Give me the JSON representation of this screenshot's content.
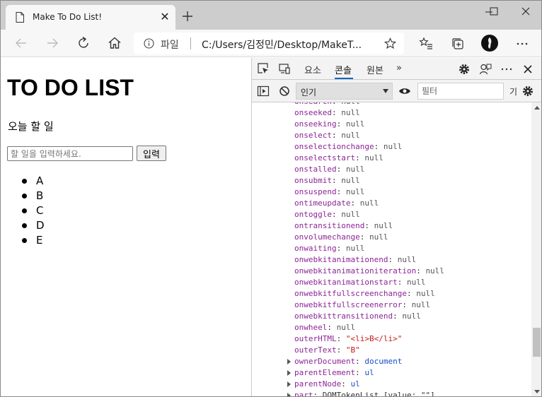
{
  "browser": {
    "tab_title": "Make To Do List!",
    "tab_close": "✕",
    "address": {
      "scheme_label": "파일",
      "url": "C:/Users/김정민/Desktop/MakeT..."
    }
  },
  "page": {
    "heading": "TO DO LIST",
    "subtitle": "오늘 할 일",
    "input_placeholder": "할 일을 입력하세요.",
    "add_button": "입력",
    "items": [
      "A",
      "B",
      "C",
      "D",
      "E"
    ]
  },
  "devtools": {
    "tabs": [
      "요소",
      "콘솔",
      "원본"
    ],
    "active_tab": "콘솔",
    "more_tabs": "»",
    "context": "인기",
    "filter_placeholder": "필터",
    "levels_label": "기",
    "lines": [
      {
        "key": "onsearch",
        "val": "null",
        "type": "null"
      },
      {
        "key": "onseeked",
        "val": "null",
        "type": "null"
      },
      {
        "key": "onseeking",
        "val": "null",
        "type": "null"
      },
      {
        "key": "onselect",
        "val": "null",
        "type": "null"
      },
      {
        "key": "onselectionchange",
        "val": "null",
        "type": "null"
      },
      {
        "key": "onselectstart",
        "val": "null",
        "type": "null"
      },
      {
        "key": "onstalled",
        "val": "null",
        "type": "null"
      },
      {
        "key": "onsubmit",
        "val": "null",
        "type": "null"
      },
      {
        "key": "onsuspend",
        "val": "null",
        "type": "null"
      },
      {
        "key": "ontimeupdate",
        "val": "null",
        "type": "null"
      },
      {
        "key": "ontoggle",
        "val": "null",
        "type": "null"
      },
      {
        "key": "ontransitionend",
        "val": "null",
        "type": "null"
      },
      {
        "key": "onvolumechange",
        "val": "null",
        "type": "null"
      },
      {
        "key": "onwaiting",
        "val": "null",
        "type": "null"
      },
      {
        "key": "onwebkitanimationend",
        "val": "null",
        "type": "null"
      },
      {
        "key": "onwebkitanimationiteration",
        "val": "null",
        "type": "null"
      },
      {
        "key": "onwebkitanimationstart",
        "val": "null",
        "type": "null"
      },
      {
        "key": "onwebkitfullscreenchange",
        "val": "null",
        "type": "null"
      },
      {
        "key": "onwebkitfullscreenerror",
        "val": "null",
        "type": "null"
      },
      {
        "key": "onwebkittransitionend",
        "val": "null",
        "type": "null"
      },
      {
        "key": "onwheel",
        "val": "null",
        "type": "null"
      },
      {
        "key": "outerHTML",
        "val": "\"<li>B</li>\"",
        "type": "string"
      },
      {
        "key": "outerText",
        "val": "\"B\"",
        "type": "string"
      },
      {
        "key": "ownerDocument",
        "val": "document",
        "type": "object",
        "expandable": true
      },
      {
        "key": "parentElement",
        "val": "ul",
        "type": "object",
        "expandable": true
      },
      {
        "key": "parentNode",
        "val": "ul",
        "type": "object",
        "expandable": true
      },
      {
        "key": "part",
        "val": "DOMTokenList [value: \"\"]",
        "type": "plain",
        "expandable": true
      }
    ]
  }
}
